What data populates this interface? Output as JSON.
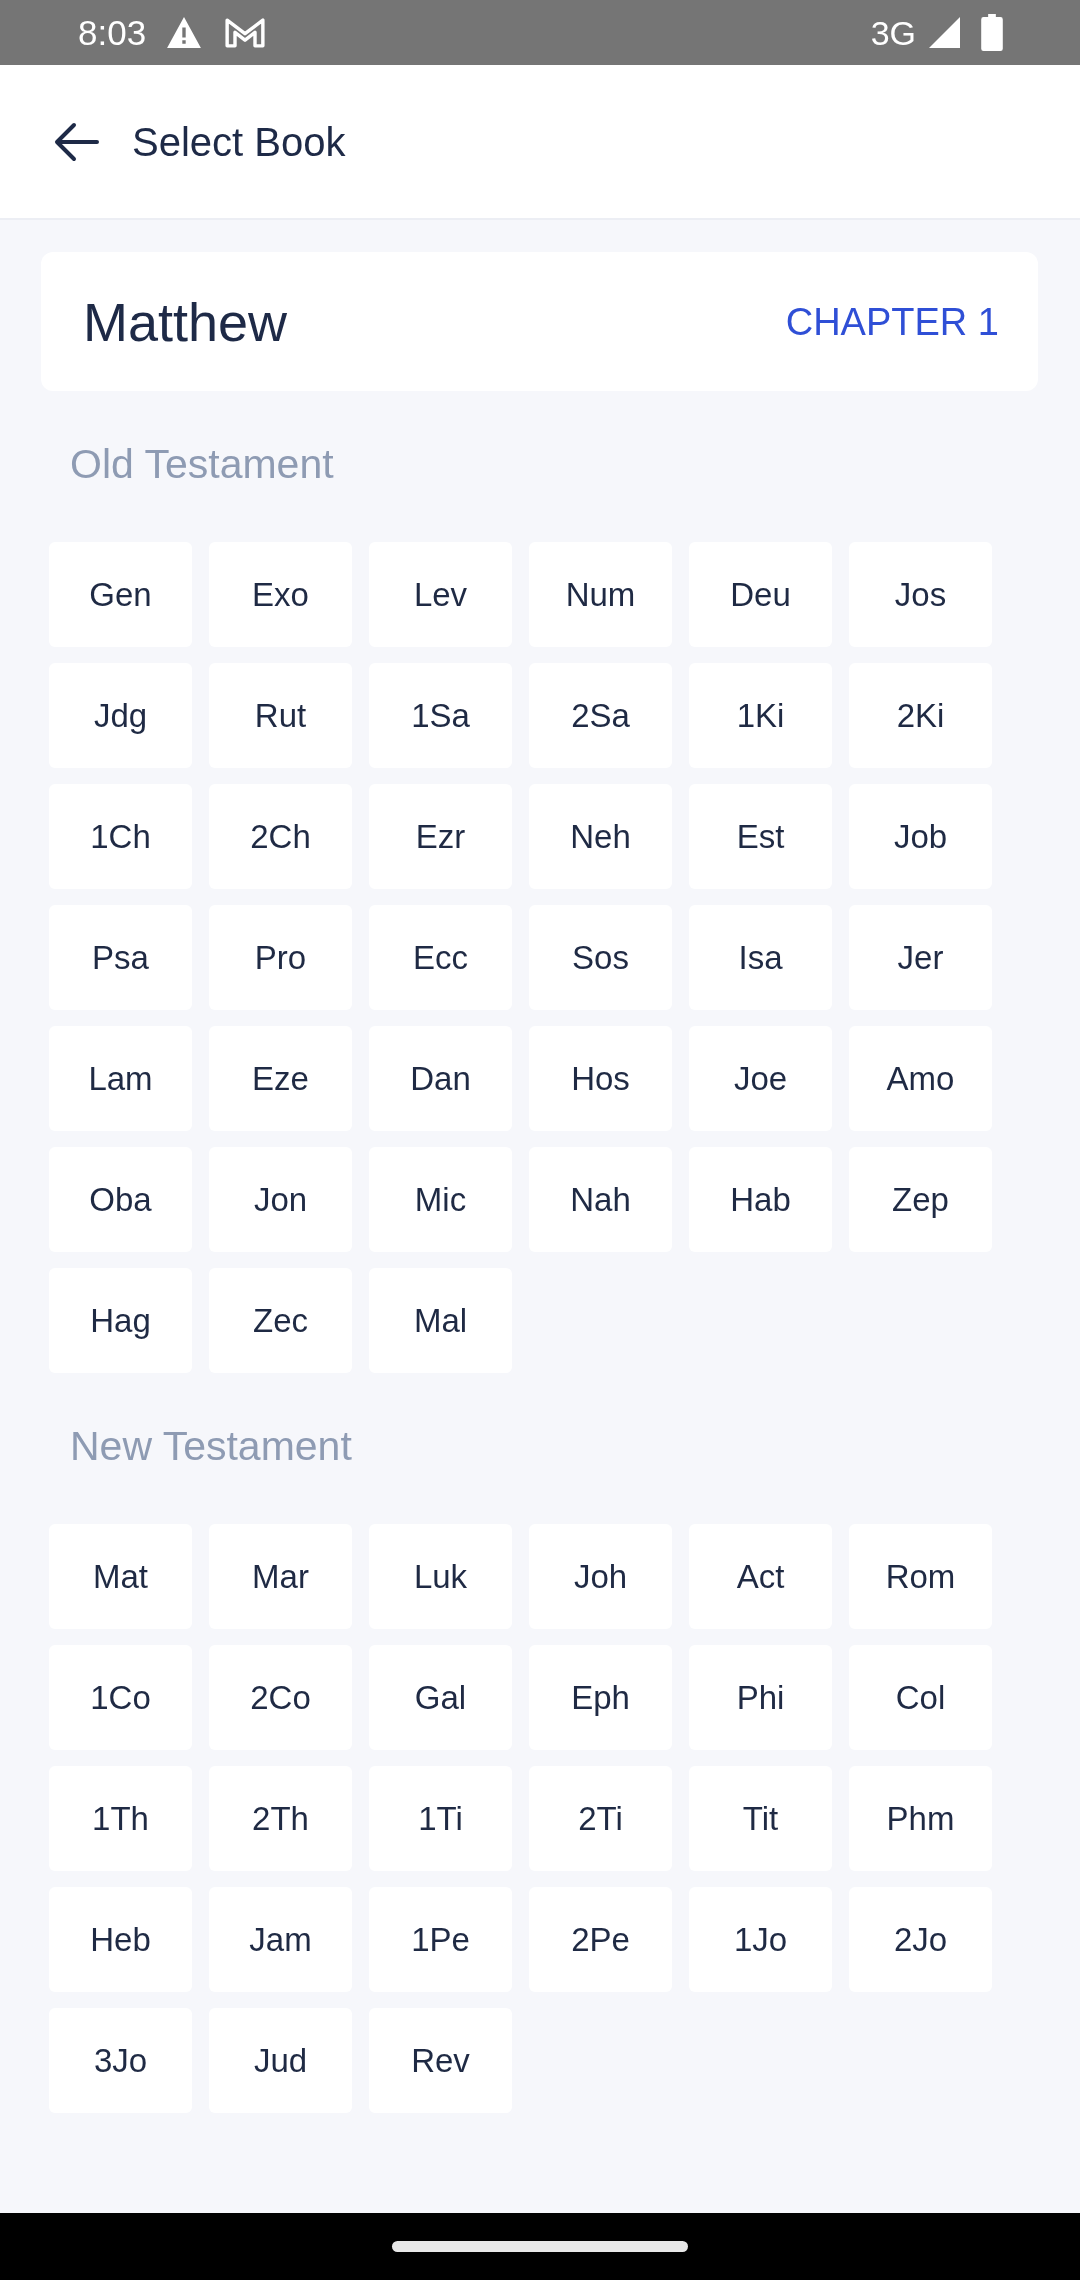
{
  "status_bar": {
    "time": "8:03",
    "network": "3G"
  },
  "app_bar": {
    "title": "Select Book"
  },
  "current": {
    "book": "Matthew",
    "chapter": "CHAPTER 1"
  },
  "sections": [
    {
      "title": "Old Testament",
      "books": [
        "Gen",
        "Exo",
        "Lev",
        "Num",
        "Deu",
        "Jos",
        "Jdg",
        "Rut",
        "1Sa",
        "2Sa",
        "1Ki",
        "2Ki",
        "1Ch",
        "2Ch",
        "Ezr",
        "Neh",
        "Est",
        "Job",
        "Psa",
        "Pro",
        "Ecc",
        "Sos",
        "Isa",
        "Jer",
        "Lam",
        "Eze",
        "Dan",
        "Hos",
        "Joe",
        "Amo",
        "Oba",
        "Jon",
        "Mic",
        "Nah",
        "Hab",
        "Zep",
        "Hag",
        "Zec",
        "Mal"
      ]
    },
    {
      "title": "New Testament",
      "books": [
        "Mat",
        "Mar",
        "Luk",
        "Joh",
        "Act",
        "Rom",
        "1Co",
        "2Co",
        "Gal",
        "Eph",
        "Phi",
        "Col",
        "1Th",
        "2Th",
        "1Ti",
        "2Ti",
        "Tit",
        "Phm",
        "Heb",
        "Jam",
        "1Pe",
        "2Pe",
        "1Jo",
        "2Jo",
        "3Jo",
        "Jud",
        "Rev"
      ]
    }
  ]
}
